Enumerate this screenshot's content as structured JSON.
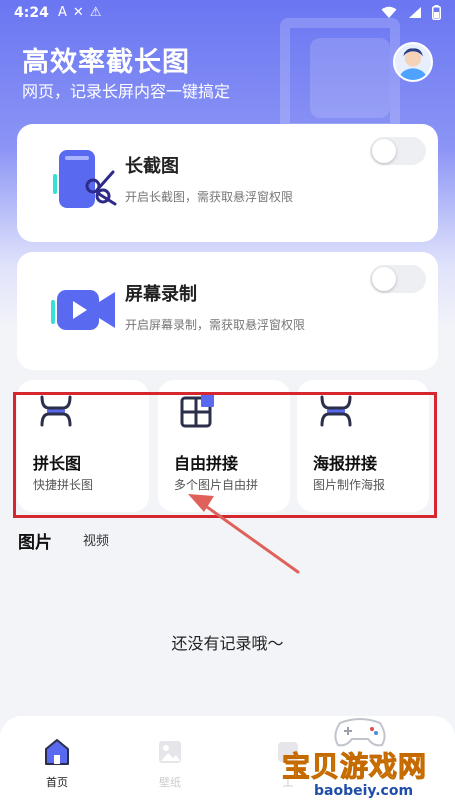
{
  "status_bar": {
    "time": "4:24",
    "left_icons": [
      "A",
      "✕",
      "⚠"
    ],
    "right_icons": [
      "wifi",
      "signal",
      "battery"
    ]
  },
  "header": {
    "title": "高效率截长图",
    "subtitle": "网页，记录长屏内容一键搞定"
  },
  "cards": [
    {
      "title": "长截图",
      "description": "开启长截图，需获取悬浮窗权限",
      "toggle_on": false,
      "icon": "phone-scissors-icon"
    },
    {
      "title": "屏幕录制",
      "description": "开启屏幕录制，需获取悬浮窗权限",
      "toggle_on": false,
      "icon": "video-camera-icon"
    }
  ],
  "tools": [
    {
      "title": "拼长图",
      "description": "快捷拼长图",
      "icon": "stitch-long-icon"
    },
    {
      "title": "自由拼接",
      "description": "多个图片自由拼",
      "icon": "grid-collage-icon"
    },
    {
      "title": "海报拼接",
      "description": "图片制作海报",
      "icon": "poster-stitch-icon"
    }
  ],
  "tabs": {
    "images": "图片",
    "videos": "视频"
  },
  "empty_message": "还没有记录哦～",
  "bottom_nav": {
    "home": "首页",
    "wallpaper": "壁纸",
    "tools": "工"
  },
  "watermark": {
    "text": "宝贝游戏网",
    "url": "baobeiy.com"
  },
  "colors": {
    "brand": "#6a76f2",
    "highlight": "#d6272f",
    "watermark": "#f4a623"
  }
}
